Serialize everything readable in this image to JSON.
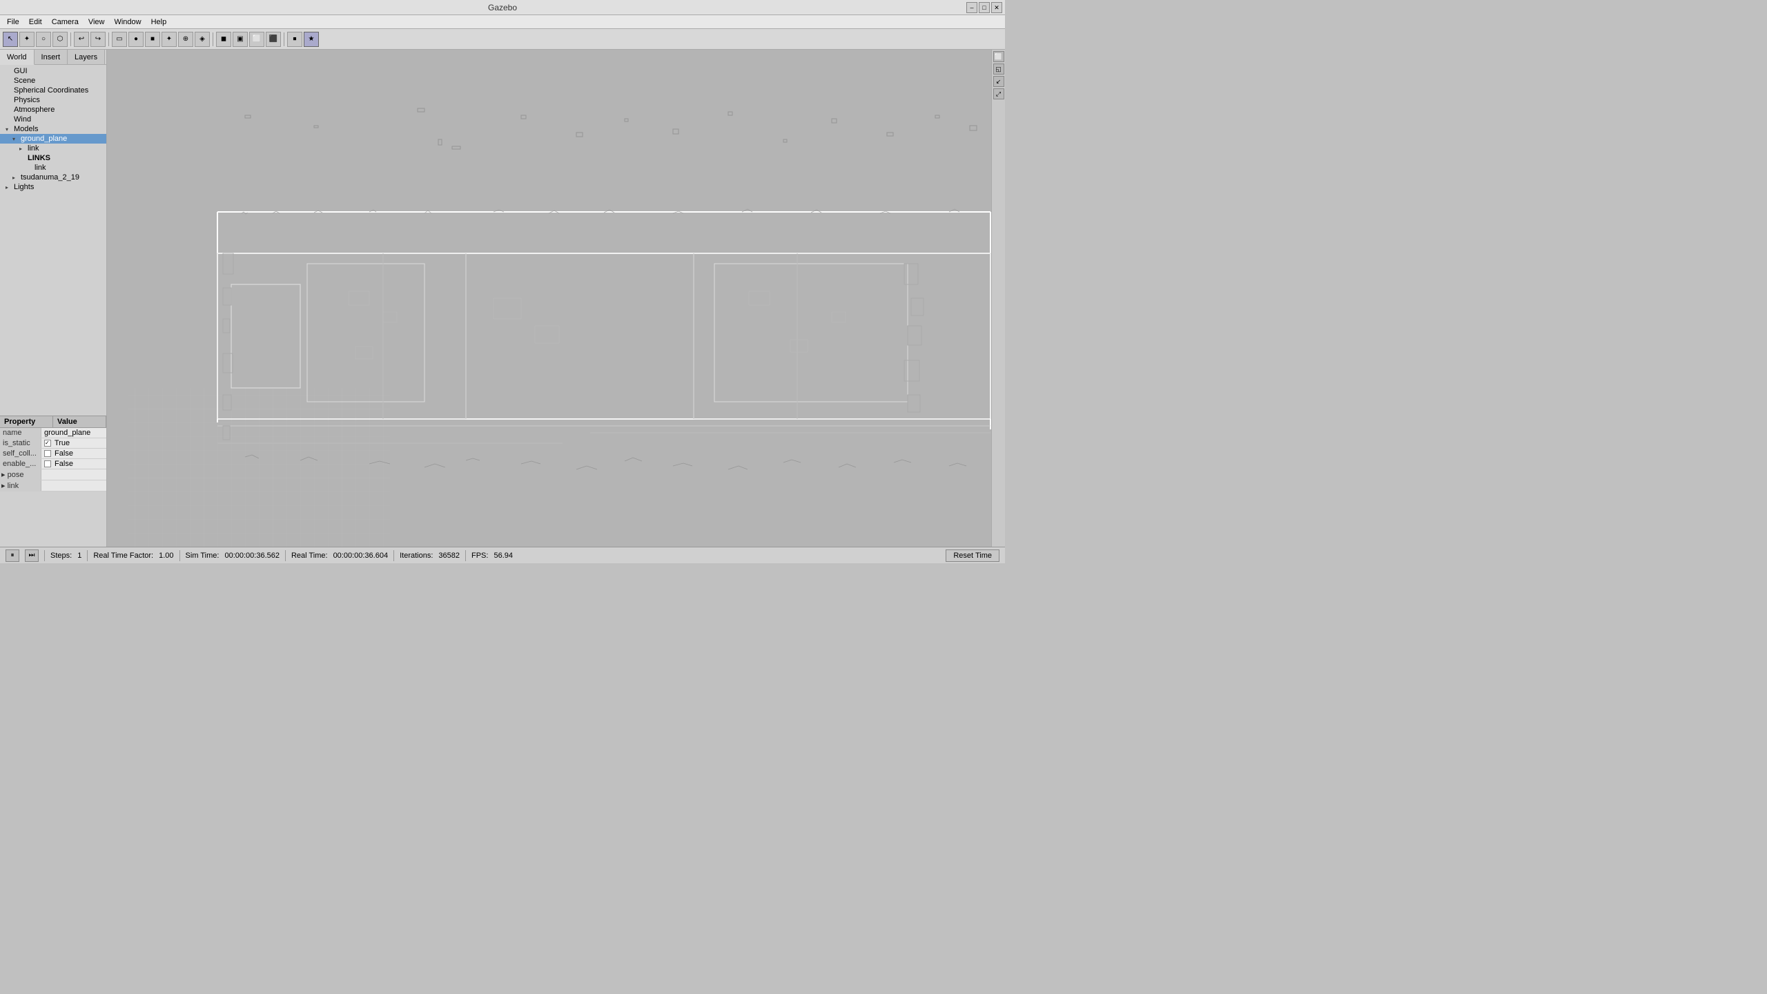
{
  "window": {
    "title": "Gazebo",
    "controls": [
      "–",
      "□",
      "✕"
    ]
  },
  "menu": {
    "items": [
      "File",
      "Edit",
      "Camera",
      "View",
      "Window",
      "Help"
    ]
  },
  "toolbar": {
    "groups": [
      {
        "buttons": [
          "↖",
          "✦",
          "○",
          "⬡",
          "↗",
          "↩",
          "↪"
        ]
      },
      {
        "buttons": [
          "▭",
          "●",
          "■",
          "✦",
          "⊕",
          "◈",
          "◼",
          "▣",
          "⬜",
          "⬛",
          "⏹",
          "★"
        ]
      },
      {
        "buttons": []
      }
    ]
  },
  "left_panel": {
    "tabs": [
      "World",
      "Insert",
      "Layers"
    ],
    "active_tab": "World",
    "tree": {
      "items": [
        {
          "label": "GUI",
          "indent": 1,
          "arrow": false
        },
        {
          "label": "Scene",
          "indent": 1,
          "arrow": false
        },
        {
          "label": "Spherical Coordinates",
          "indent": 1,
          "arrow": false
        },
        {
          "label": "Physics",
          "indent": 1,
          "arrow": false
        },
        {
          "label": "Atmosphere",
          "indent": 1,
          "arrow": false
        },
        {
          "label": "Wind",
          "indent": 1,
          "arrow": false
        },
        {
          "label": "Models",
          "indent": 1,
          "arrow": true,
          "expanded": true
        },
        {
          "label": "ground_plane",
          "indent": 2,
          "arrow": true,
          "expanded": true,
          "selected": true
        },
        {
          "label": "link",
          "indent": 3,
          "arrow": true,
          "expanded": false
        },
        {
          "label": "LINKS",
          "indent": 3,
          "arrow": false
        },
        {
          "label": "link",
          "indent": 4,
          "arrow": false
        },
        {
          "label": "tsudanuma_2_19",
          "indent": 3,
          "arrow": true,
          "expanded": false
        },
        {
          "label": "Lights",
          "indent": 1,
          "arrow": true,
          "expanded": false
        }
      ]
    }
  },
  "properties": {
    "header": {
      "col1": "Property",
      "col2": "Value"
    },
    "rows": [
      {
        "name": "name",
        "value": "ground_plane",
        "type": "text"
      },
      {
        "name": "is_static",
        "value": "True",
        "type": "checkbox",
        "checked": true
      },
      {
        "name": "self_coll...",
        "value": "False",
        "type": "checkbox",
        "checked": false
      },
      {
        "name": "enable_...",
        "value": "False",
        "type": "checkbox",
        "checked": false
      },
      {
        "name": "pose",
        "value": "",
        "type": "expandable"
      },
      {
        "name": "link",
        "value": "",
        "type": "expandable"
      }
    ]
  },
  "status_bar": {
    "play_btn": "⏸",
    "step_forward": "⏭",
    "steps_label": "Steps:",
    "steps_value": "1",
    "realtime_factor_label": "Real Time Factor:",
    "realtime_factor_value": "1.00",
    "sim_time_label": "Sim Time:",
    "sim_time_value": "00:00:00:36.562",
    "real_time_label": "Real Time:",
    "real_time_value": "00:00:00:36.604",
    "iterations_label": "Iterations:",
    "iterations_value": "36582",
    "fps_label": "FPS:",
    "fps_value": "56.94",
    "reset_btn": "Reset Time"
  },
  "viewport_icons": [
    "⬜",
    "◱",
    "↙↗",
    "⤢"
  ]
}
